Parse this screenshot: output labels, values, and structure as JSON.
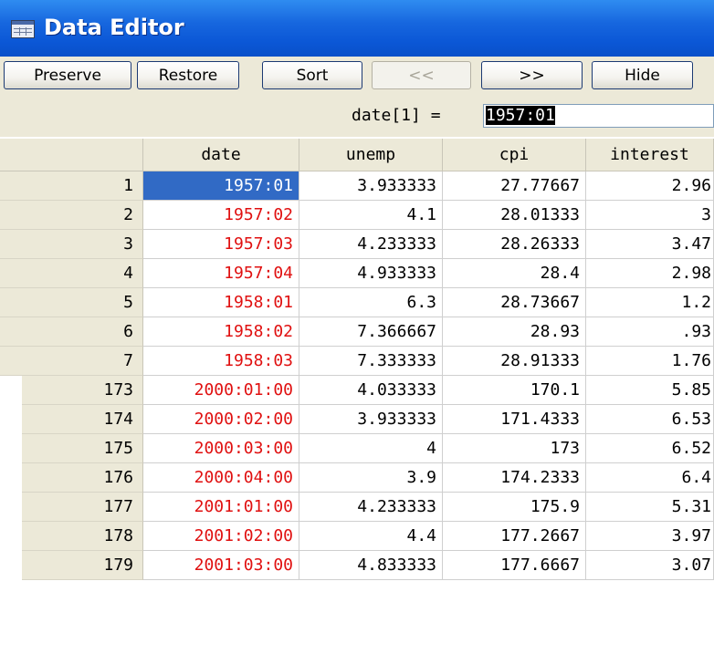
{
  "window": {
    "title": "Data Editor"
  },
  "toolbar": {
    "preserve": "Preserve",
    "restore": "Restore",
    "sort": "Sort",
    "prev": "<<",
    "next": ">>",
    "hide": "Hide"
  },
  "cell": {
    "reference": "date[1] =",
    "value": "1957:01"
  },
  "columns": [
    "date",
    "unemp",
    "cpi",
    "interest"
  ],
  "rows": [
    {
      "n": "1",
      "date": "1957:01",
      "unemp": "3.933333",
      "cpi": "27.77667",
      "interest": "2.96"
    },
    {
      "n": "2",
      "date": "1957:02",
      "unemp": "4.1",
      "cpi": "28.01333",
      "interest": "3"
    },
    {
      "n": "3",
      "date": "1957:03",
      "unemp": "4.233333",
      "cpi": "28.26333",
      "interest": "3.47"
    },
    {
      "n": "4",
      "date": "1957:04",
      "unemp": "4.933333",
      "cpi": "28.4",
      "interest": "2.98"
    },
    {
      "n": "5",
      "date": "1958:01",
      "unemp": "6.3",
      "cpi": "28.73667",
      "interest": "1.2"
    },
    {
      "n": "6",
      "date": "1958:02",
      "unemp": "7.366667",
      "cpi": "28.93",
      "interest": ".93"
    },
    {
      "n": "7",
      "date": "1958:03",
      "unemp": "7.333333",
      "cpi": "28.91333",
      "interest": "1.76"
    },
    {
      "n": "173",
      "date": "2000:01:00",
      "unemp": "4.033333",
      "cpi": "170.1",
      "interest": "5.85"
    },
    {
      "n": "174",
      "date": "2000:02:00",
      "unemp": "3.933333",
      "cpi": "171.4333",
      "interest": "6.53"
    },
    {
      "n": "175",
      "date": "2000:03:00",
      "unemp": "4",
      "cpi": "173",
      "interest": "6.52"
    },
    {
      "n": "176",
      "date": "2000:04:00",
      "unemp": "3.9",
      "cpi": "174.2333",
      "interest": "6.4"
    },
    {
      "n": "177",
      "date": "2001:01:00",
      "unemp": "4.233333",
      "cpi": "175.9",
      "interest": "5.31"
    },
    {
      "n": "178",
      "date": "2001:02:00",
      "unemp": "4.4",
      "cpi": "177.2667",
      "interest": "3.97"
    },
    {
      "n": "179",
      "date": "2001:03:00",
      "unemp": "4.833333",
      "cpi": "177.6667",
      "interest": "3.07"
    }
  ],
  "colors": {
    "titlebar": "#0b57d6",
    "date_text": "#e01010",
    "selection": "#316ac5",
    "chrome": "#ece9d8"
  },
  "icons": {
    "window": "data-grid-icon"
  }
}
